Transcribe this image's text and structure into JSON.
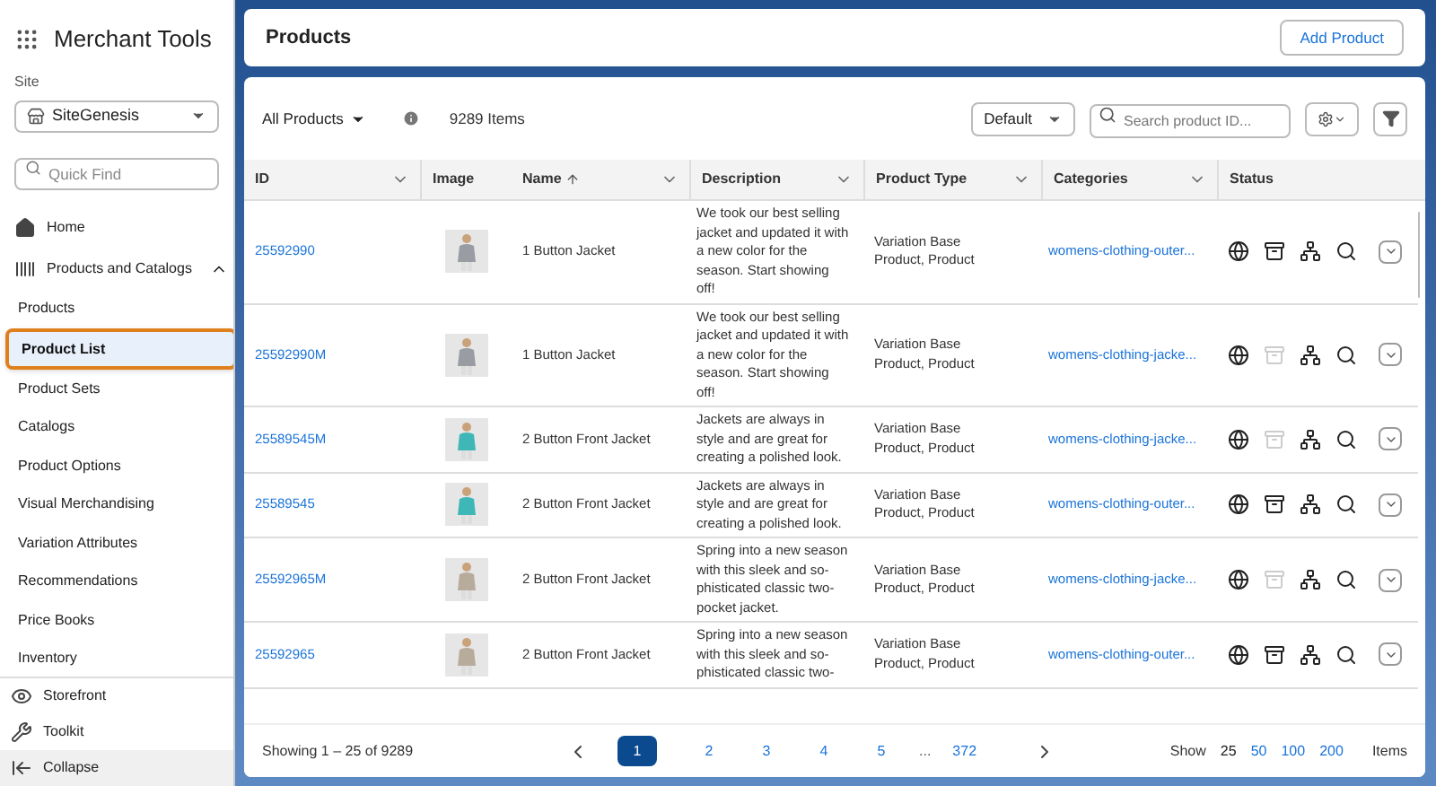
{
  "sidebar": {
    "title": "Merchant Tools",
    "site_label": "Site",
    "site_value": "SiteGenesis",
    "search": {
      "placeholder": "Quick Find"
    },
    "nav": [
      {
        "label": "Home",
        "kind": "home"
      },
      {
        "label": "Products and Catalogs",
        "kind": "group",
        "expanded": true,
        "children": [
          {
            "label": "Products",
            "selected": false
          },
          {
            "label": "Product List",
            "selected": true
          },
          {
            "label": "Product Sets",
            "selected": false
          },
          {
            "label": "Catalogs",
            "selected": false
          },
          {
            "label": "Product Options",
            "selected": false
          },
          {
            "label": "Visual Merchandising",
            "selected": false
          },
          {
            "label": "Variation Attributes",
            "selected": false
          },
          {
            "label": "Recommendations",
            "selected": false
          },
          {
            "label": "Price Books",
            "selected": false
          },
          {
            "label": "Inventory",
            "selected": false
          }
        ]
      }
    ],
    "footer": [
      {
        "label": "Storefront",
        "kind": "storefront"
      },
      {
        "label": "Toolkit",
        "kind": "toolkit"
      },
      {
        "label": "Collapse",
        "kind": "collapse"
      }
    ]
  },
  "header": {
    "title": "Products",
    "button": "Add Product"
  },
  "toolbar": {
    "view": "All Products",
    "count": "9289 Items",
    "sort": "Default",
    "search": {
      "placeholder": "Search product ID..."
    }
  },
  "table": {
    "columns": [
      {
        "label": "ID",
        "menu": true,
        "sorted": false
      },
      {
        "label": "Image",
        "menu": false,
        "sorted": false
      },
      {
        "label": "Name",
        "menu": true,
        "sorted": true
      },
      {
        "label": "Description",
        "menu": true,
        "sorted": false
      },
      {
        "label": "Product Type",
        "menu": true,
        "sorted": false
      },
      {
        "label": "Categories",
        "menu": true,
        "sorted": false
      },
      {
        "label": "Status",
        "menu": false,
        "sorted": false
      }
    ],
    "rows": [
      {
        "id": "25592990",
        "name": "1 Button Jacket",
        "description": "We took our best selling jacket and updated it with a new color for the season. Start showing off!",
        "type": "Variation Base Product, Product",
        "category": "womens-clothing-outer...",
        "archive_active": true
      },
      {
        "id": "25592990M",
        "name": "1 Button Jacket",
        "description": "We took our best selling jacket and updated it with a new color for the season. Start showing off!",
        "type": "Variation Base Product, Product",
        "category": "womens-clothing-jacke...",
        "archive_active": false
      },
      {
        "id": "25589545M",
        "name": "2 Button Front Jacket",
        "description": "Jackets are always in style and are great for creating a polished look.",
        "type": "Variation Base Product, Product",
        "category": "womens-clothing-jacke...",
        "archive_active": false
      },
      {
        "id": "25589545",
        "name": "2 Button Front Jacket",
        "description": "Jackets are always in style and are great for creating a polished look.",
        "type": "Variation Base Product, Product",
        "category": "womens-clothing-outer...",
        "archive_active": true
      },
      {
        "id": "25592965M",
        "name": "2 Button Front Jacket",
        "description": "Spring into a new season with this sleek and so-phisticated classic two-pocket jacket.",
        "type": "Variation Base Product, Product",
        "category": "womens-clothing-jacke...",
        "archive_active": false
      },
      {
        "id": "25592965",
        "name": "2 Button Front Jacket",
        "description": "Spring into a new season with this sleek and so-phisticated classic two-",
        "type": "Variation Base Product, Product",
        "category": "womens-clothing-outer...",
        "archive_active": true
      }
    ]
  },
  "footer": {
    "showing": "Showing 1 – 25 of 9289",
    "pages": [
      {
        "label": "1",
        "selected": true
      },
      {
        "label": "2",
        "selected": false
      },
      {
        "label": "3",
        "selected": false
      },
      {
        "label": "4",
        "selected": false
      },
      {
        "label": "5",
        "selected": false
      }
    ],
    "ellipsis": "...",
    "last_page": "372",
    "show_label": "Show",
    "sizes": [
      {
        "label": "25",
        "selected": true
      },
      {
        "label": "50",
        "selected": false
      },
      {
        "label": "100",
        "selected": false
      },
      {
        "label": "200",
        "selected": false
      }
    ],
    "items_label": "Items"
  }
}
